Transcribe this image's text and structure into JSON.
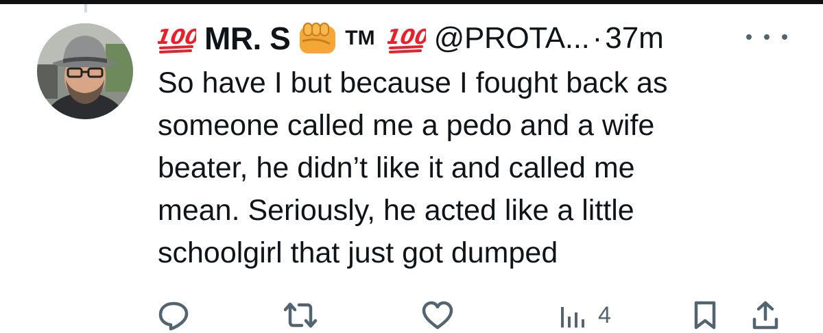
{
  "tweet": {
    "display_name": "MR. S",
    "tm": "TM",
    "handle": "@PROTA...",
    "separator": "·",
    "time": "37m",
    "text": "So have I but because I fought back as\nsomeone called me a pedo and a wife\nbeater, he didn’t like it and called me\nmean. Seriously, he acted like a little\nschoolgirl that just got dumped",
    "emojis": [
      "hundred-points",
      "oncoming-fist",
      "hundred-points"
    ]
  },
  "actions": {
    "views_count": "4"
  },
  "icons": [
    "reply-icon",
    "retweet-icon",
    "like-icon",
    "views-icon",
    "bookmark-icon",
    "share-icon",
    "more-icon"
  ],
  "colors": {
    "text": "#0f1419",
    "secondary": "#536471",
    "emoji_red": "#e8202b",
    "fist": "#f4a637"
  }
}
